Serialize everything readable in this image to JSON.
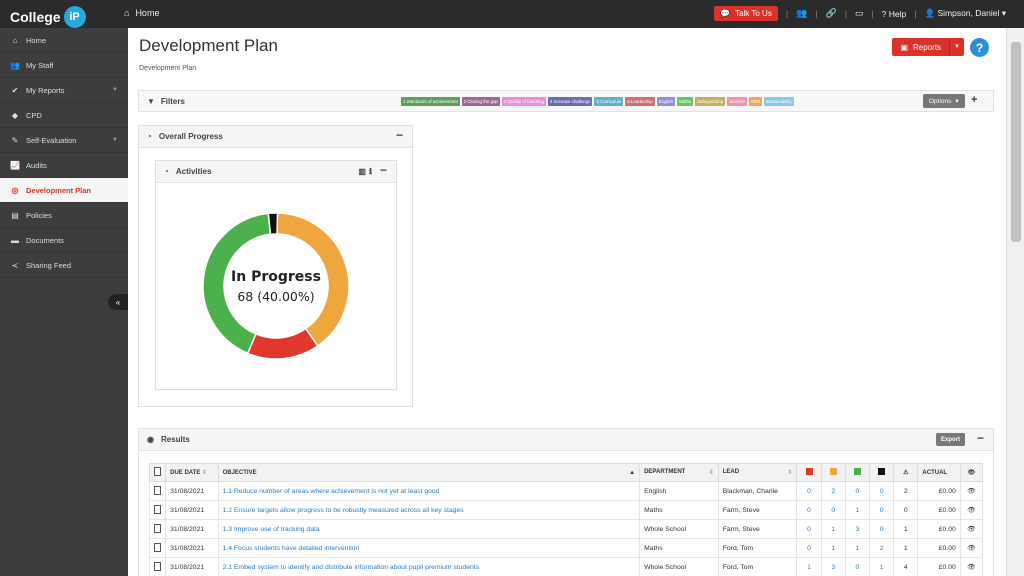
{
  "app": {
    "logo_text": "College",
    "logo_badge": "iP"
  },
  "topbar": {
    "home": "Home",
    "talk": "Talk To Us",
    "help": "Help",
    "user": "Simpson, Daniel"
  },
  "sidebar": {
    "items": [
      {
        "label": "Home",
        "icon": "home-icon"
      },
      {
        "label": "My Staff",
        "icon": "users-icon"
      },
      {
        "label": "My Reports",
        "icon": "check-icon"
      },
      {
        "label": "CPD",
        "icon": "ticket-icon"
      },
      {
        "label": "Self-Evaluation",
        "icon": "edit-icon"
      },
      {
        "label": "Audits",
        "icon": "chart-icon"
      },
      {
        "label": "Development Plan",
        "icon": "target-icon"
      },
      {
        "label": "Policies",
        "icon": "file-icon"
      },
      {
        "label": "Documents",
        "icon": "folder-icon"
      },
      {
        "label": "Sharing Feed",
        "icon": "share-icon"
      }
    ],
    "collapse": "«"
  },
  "page": {
    "title": "Development Plan",
    "breadcrumb": "Development Plan",
    "reports": "Reports",
    "help": "?"
  },
  "filters": {
    "title": "Filters",
    "options": "Options",
    "tags": [
      {
        "label": "1 Standards of achievement",
        "color": "#5c9e5c"
      },
      {
        "label": "2 Closing the gap",
        "color": "#9b6a8e"
      },
      {
        "label": "3 Quality of teaching",
        "color": "#e88fd8"
      },
      {
        "label": "4 Increase challenge",
        "color": "#6c6cae"
      },
      {
        "label": "5 Curriculum",
        "color": "#5fb0c9"
      },
      {
        "label": "6 Leadership",
        "color": "#d07070"
      },
      {
        "label": "English",
        "color": "#8f8fd6"
      },
      {
        "label": "Maths",
        "color": "#6ac46a"
      },
      {
        "label": "Safeguarding",
        "color": "#c4b060"
      },
      {
        "label": "Science",
        "color": "#f093a8"
      },
      {
        "label": "SEN",
        "color": "#f0a860"
      },
      {
        "label": "Sustainability",
        "color": "#8ec6e6"
      }
    ]
  },
  "overall": {
    "title": "Overall Progress"
  },
  "activities": {
    "title": "Activities",
    "center_title": "In Progress",
    "center_sub": "68 (40.00%)"
  },
  "chart_data": {
    "type": "pie",
    "categories": [
      "In Progress",
      "Overdue",
      "Complete",
      "Not started"
    ],
    "values": [
      40,
      16,
      42,
      2
    ],
    "colors": [
      "#f0a63f",
      "#e2382b",
      "#4cb14d",
      "#111111"
    ]
  },
  "results": {
    "title": "Results",
    "export": "Export",
    "columns": [
      "DUE DATE",
      "OBJECTIVE",
      "DEPARTMENT",
      "LEAD",
      "ACTUAL"
    ],
    "rows": [
      {
        "due": "31/08/2021",
        "objective": "1.1 Reduce number of areas where achievement is not yet at least good",
        "dept": "English",
        "lead": "Blackman, Charlie",
        "r": "0",
        "a": "2",
        "g": "0",
        "b": "0",
        "warn": "2",
        "actual": "£0.00"
      },
      {
        "due": "31/08/2021",
        "objective": "1.2 Ensure targets allow progress to be robustly measured across all key stages",
        "dept": "Maths",
        "lead": "Farm, Steve",
        "r": "0",
        "a": "0",
        "g": "1",
        "b": "0",
        "warn": "0",
        "actual": "£0.00"
      },
      {
        "due": "31/08/2021",
        "objective": "1.3 Improve use of tracking data",
        "dept": "Whole School",
        "lead": "Farm, Steve",
        "r": "0",
        "a": "1",
        "g": "3",
        "b": "0",
        "warn": "1",
        "actual": "£0.00"
      },
      {
        "due": "31/08/2021",
        "objective": "1.4 Focus students have detailed intervention",
        "dept": "Maths",
        "lead": "Ford, Tom",
        "r": "0",
        "a": "1",
        "g": "1",
        "b": "2",
        "warn": "1",
        "actual": "£0.00"
      },
      {
        "due": "31/08/2021",
        "objective": "2.1 Embed system to identify and distribute information about pupil premium students",
        "dept": "Whole School",
        "lead": "Ford, Tom",
        "r": "1",
        "a": "3",
        "g": "0",
        "b": "1",
        "warn": "4",
        "actual": "£0.00"
      }
    ]
  }
}
